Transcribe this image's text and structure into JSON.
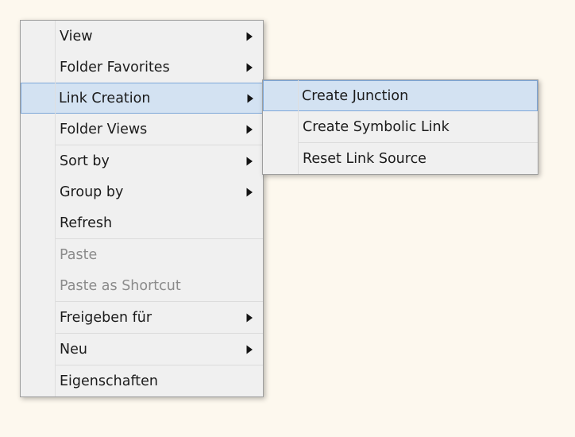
{
  "colors": {
    "desktop_background": "#fdf8ee",
    "menu_background": "#f0f0f0",
    "menu_border": "#9e9e9e",
    "text": "#1b1b1b",
    "disabled_text": "#8b8b8b",
    "highlight_fill": "#d3e2f2",
    "highlight_border": "#7da7d9",
    "separator": "#dcdcdc",
    "gutter_line": "#dedede"
  },
  "context_menu": {
    "name": "folder-context-menu",
    "items": [
      {
        "label": "View",
        "submenu": true,
        "disabled": false,
        "highlighted": false,
        "separator_after": false
      },
      {
        "label": "Folder Favorites",
        "submenu": true,
        "disabled": false,
        "highlighted": false,
        "separator_after": false
      },
      {
        "label": "Link Creation",
        "submenu": true,
        "disabled": false,
        "highlighted": true,
        "separator_after": false
      },
      {
        "label": "Folder Views",
        "submenu": true,
        "disabled": false,
        "highlighted": false,
        "separator_after": true
      },
      {
        "label": "Sort by",
        "submenu": true,
        "disabled": false,
        "highlighted": false,
        "separator_after": false
      },
      {
        "label": "Group by",
        "submenu": true,
        "disabled": false,
        "highlighted": false,
        "separator_after": false
      },
      {
        "label": "Refresh",
        "submenu": false,
        "disabled": false,
        "highlighted": false,
        "separator_after": true
      },
      {
        "label": "Paste",
        "submenu": false,
        "disabled": true,
        "highlighted": false,
        "separator_after": false
      },
      {
        "label": "Paste as Shortcut",
        "submenu": false,
        "disabled": true,
        "highlighted": false,
        "separator_after": true
      },
      {
        "label": "Freigeben für",
        "submenu": true,
        "disabled": false,
        "highlighted": false,
        "separator_after": true
      },
      {
        "label": "Neu",
        "submenu": true,
        "disabled": false,
        "highlighted": false,
        "separator_after": true
      },
      {
        "label": "Eigenschaften",
        "submenu": false,
        "disabled": false,
        "highlighted": false,
        "separator_after": false
      }
    ]
  },
  "sub_menu": {
    "name": "link-creation-submenu",
    "parent_item": "Link Creation",
    "items": [
      {
        "label": "Create Junction",
        "submenu": false,
        "disabled": false,
        "highlighted": true,
        "separator_after": false
      },
      {
        "label": "Create Symbolic Link",
        "submenu": false,
        "disabled": false,
        "highlighted": false,
        "separator_after": true
      },
      {
        "label": "Reset Link Source",
        "submenu": false,
        "disabled": false,
        "highlighted": false,
        "separator_after": false
      }
    ]
  },
  "icons": {
    "submenu_arrow": "chevron-right-icon"
  }
}
